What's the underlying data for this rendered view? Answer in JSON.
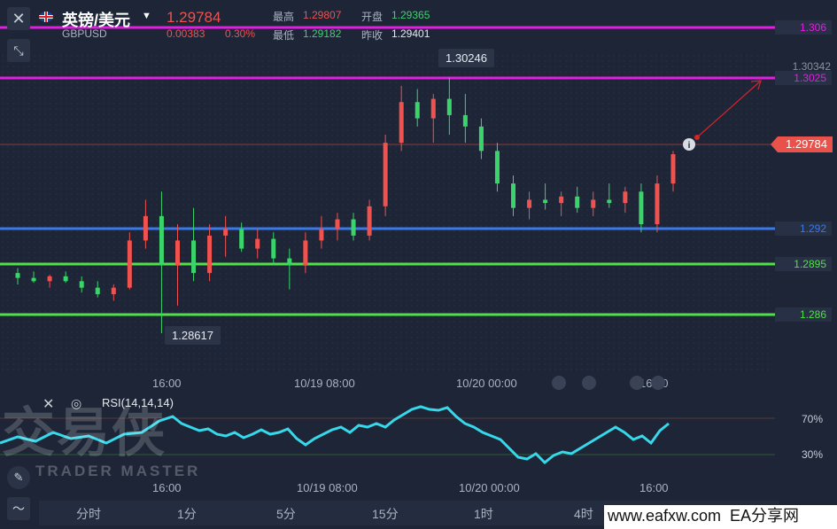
{
  "header": {
    "close_icon": "close-icon",
    "collapse_icon": "collapse-arrows-icon",
    "flag_icon": "uk-flag-icon",
    "title": "英镑/美元",
    "symbol": "GBPUSD",
    "price": "1.29784",
    "change_abs": "0.00383",
    "change_pct": "0.30%",
    "high_label": "最高",
    "high_value": "1.29807",
    "low_label": "最低",
    "low_value": "1.29182",
    "open_label": "开盘",
    "open_value": "1.29365",
    "prev_close_label": "昨收",
    "prev_close_value": "1.29401"
  },
  "levels": {
    "l1": "1.306",
    "l2": "1.30342",
    "l3": "1.3025",
    "l4": "1.29784",
    "l5": "1.292",
    "l6": "1.2895",
    "l7": "1.286"
  },
  "callouts": {
    "high": "1.30246",
    "low": "1.28617"
  },
  "x_axis": {
    "t1": "16:00",
    "t2": "10/19 08:00",
    "t3": "10/20 00:00",
    "t4": "16:00"
  },
  "rsi": {
    "label": "RSI(14,14,14)",
    "level_70": "70%",
    "level_30": "30%"
  },
  "timeframes": [
    "分时",
    "1分",
    "5分",
    "15分",
    "1时",
    "4时"
  ],
  "watermark": {
    "brand_cn": "交易侠",
    "brand_en": "TRADER MASTER"
  },
  "footer_site": "www.eafxw.com  EA分享网",
  "colors": {
    "up": "#f0524f",
    "down": "#3bd46b",
    "magenta": "#e21fe0",
    "blue": "#3a79e8",
    "green": "#52e04a",
    "rsi": "#36d8ea"
  },
  "chart_data": {
    "type": "candlestick",
    "ylim": [
      1.2855,
      1.307
    ],
    "horizontal_lines": [
      1.306,
      1.3025,
      1.292,
      1.2895,
      1.286
    ],
    "series": [
      {
        "values": [
          [
            1.2905,
            1.2908,
            1.2898,
            1.2902
          ],
          [
            1.2902,
            1.2906,
            1.2899,
            1.29
          ],
          [
            1.29,
            1.2904,
            1.2896,
            1.2903
          ],
          [
            1.2903,
            1.2906,
            1.2899,
            1.29
          ],
          [
            1.29,
            1.2903,
            1.2893,
            1.2896
          ],
          [
            1.2896,
            1.29,
            1.289,
            1.2892
          ],
          [
            1.2892,
            1.2898,
            1.2888,
            1.2896
          ],
          [
            1.2896,
            1.293,
            1.2895,
            1.2925
          ],
          [
            1.2925,
            1.295,
            1.292,
            1.294
          ],
          [
            1.294,
            1.2955,
            1.2868,
            1.291
          ],
          [
            1.291,
            1.2935,
            1.2885,
            1.2925
          ],
          [
            1.2925,
            1.2945,
            1.29,
            1.2905
          ],
          [
            1.2905,
            1.2935,
            1.29,
            1.2928
          ],
          [
            1.2928,
            1.294,
            1.2915,
            1.2932
          ],
          [
            1.2932,
            1.2936,
            1.2918,
            1.292
          ],
          [
            1.292,
            1.2932,
            1.2914,
            1.2926
          ],
          [
            1.2926,
            1.293,
            1.291,
            1.2914
          ],
          [
            1.2914,
            1.292,
            1.2895,
            1.291
          ],
          [
            1.291,
            1.293,
            1.2905,
            1.2925
          ],
          [
            1.2925,
            1.294,
            1.292,
            1.2932
          ],
          [
            1.2932,
            1.2942,
            1.2925,
            1.2938
          ],
          [
            1.2938,
            1.2942,
            1.2925,
            1.2928
          ],
          [
            1.2928,
            1.295,
            1.2925,
            1.2946
          ],
          [
            1.2946,
            1.299,
            1.294,
            1.2985
          ],
          [
            1.2985,
            1.302,
            1.298,
            1.301
          ],
          [
            1.301,
            1.3018,
            1.2995,
            1.3
          ],
          [
            1.3,
            1.3015,
            1.2985,
            1.3012
          ],
          [
            1.3012,
            1.3025,
            1.299,
            1.3002
          ],
          [
            1.3002,
            1.3015,
            1.2985,
            1.2995
          ],
          [
            1.2995,
            1.3,
            1.2975,
            1.298
          ],
          [
            1.298,
            1.2985,
            1.2955,
            1.296
          ],
          [
            1.296,
            1.2965,
            1.294,
            1.2945
          ],
          [
            1.2945,
            1.2955,
            1.2938,
            1.295
          ],
          [
            1.295,
            1.296,
            1.2944,
            1.2948
          ],
          [
            1.2948,
            1.2955,
            1.294,
            1.2952
          ],
          [
            1.2952,
            1.2958,
            1.2942,
            1.2945
          ],
          [
            1.2945,
            1.2955,
            1.294,
            1.295
          ],
          [
            1.295,
            1.296,
            1.2945,
            1.2948
          ],
          [
            1.2948,
            1.2958,
            1.2942,
            1.2955
          ],
          [
            1.2955,
            1.296,
            1.293,
            1.2935
          ],
          [
            1.2935,
            1.2965,
            1.293,
            1.296
          ],
          [
            1.296,
            1.298,
            1.2955,
            1.2978
          ]
        ]
      }
    ]
  }
}
